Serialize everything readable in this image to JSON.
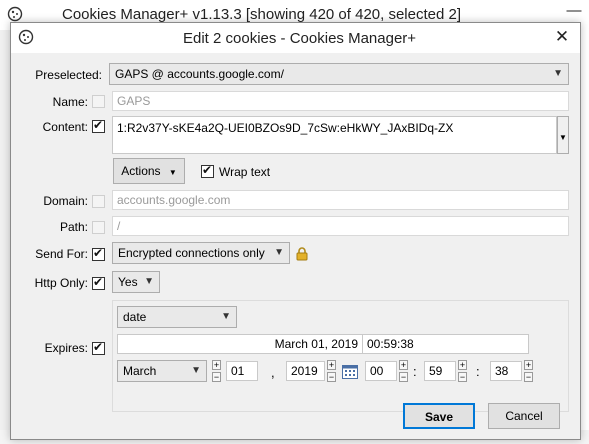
{
  "background_window": {
    "title": "Cookies Manager+ v1.13.3 [showing 420 of 420, selected 2]",
    "minimize_glyph": "—"
  },
  "dialog": {
    "title": "Edit 2 cookies - Cookies Manager+",
    "close_glyph": "✕",
    "preselected": {
      "label": "Preselected:",
      "value": "GAPS @ accounts.google.com/"
    },
    "name": {
      "label": "Name:",
      "value": "GAPS",
      "checked": false
    },
    "content": {
      "label": "Content:",
      "value": "1:R2v37Y-sKE4a2Q-UEI0BZOs9D_7cSw:eHkWY_JAxBIDq-ZX",
      "checked": true
    },
    "actions_label": "Actions",
    "wrap_text_label": "Wrap text",
    "domain": {
      "label": "Domain:",
      "value": "accounts.google.com",
      "checked": false
    },
    "path": {
      "label": "Path:",
      "value": "/",
      "checked": false
    },
    "send_for": {
      "label": "Send For:",
      "value": "Encrypted connections only",
      "checked": true
    },
    "http_only": {
      "label": "Http Only:",
      "value": "Yes",
      "checked": true
    },
    "expires": {
      "label": "Expires:",
      "checked": true,
      "type": "date",
      "date_text": "March 01, 2019",
      "time_text": "00:59:38",
      "month": "March",
      "day": "01",
      "year": "2019",
      "hour": "00",
      "minute": "59",
      "second": "38",
      "comma": ",",
      "colon": ":"
    },
    "save_label": "Save",
    "cancel_label": "Cancel"
  }
}
